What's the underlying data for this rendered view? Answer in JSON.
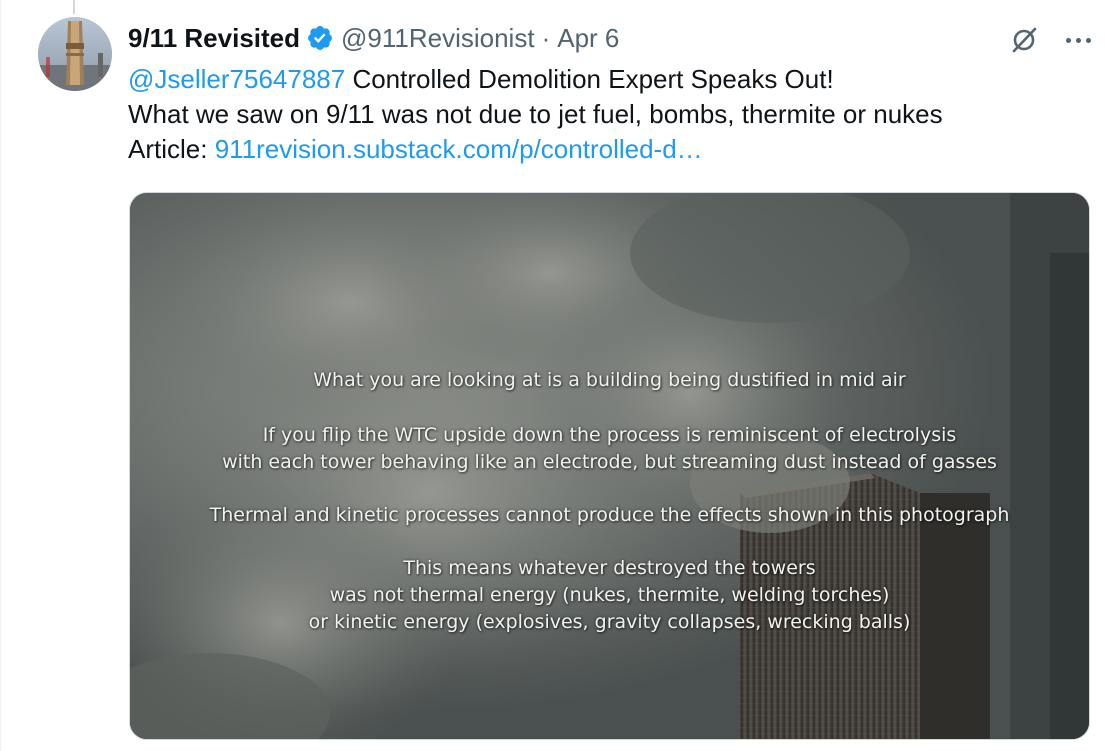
{
  "tweet": {
    "display_name": "9/11 Revisited",
    "handle": "@911Revisionist",
    "separator": "·",
    "date": "Apr 6",
    "mention": "@Jseller75647887",
    "line1_text": " Controlled Demolition Expert Speaks Out!",
    "line2_text": "What we saw on 9/11 was not due to jet fuel, bombs, thermite or nukes",
    "line3_prefix": "Article: ",
    "article_link": "911revision.substack.com/p/controlled-d…"
  },
  "icons": {
    "verified": "verified-badge-icon",
    "grok": "grok-icon",
    "more": "more-icon"
  },
  "colors": {
    "link": "#1d9bf0",
    "verified": "#1d9bf0",
    "secondary_text": "#536471"
  },
  "media": {
    "overlay_lines": [
      "What you are looking at is a building being dustified in mid air",
      "If you flip the WTC upside down the process is reminiscent of electrolysis",
      "with each tower behaving like an electrode, but streaming dust instead of gasses",
      "Thermal and kinetic processes cannot produce the effects shown in this photograph",
      "This means whatever destroyed the towers",
      "was not thermal energy (nukes, thermite, welding torches)",
      "or kinetic energy (explosives, gravity collapses, wrecking balls)"
    ]
  }
}
